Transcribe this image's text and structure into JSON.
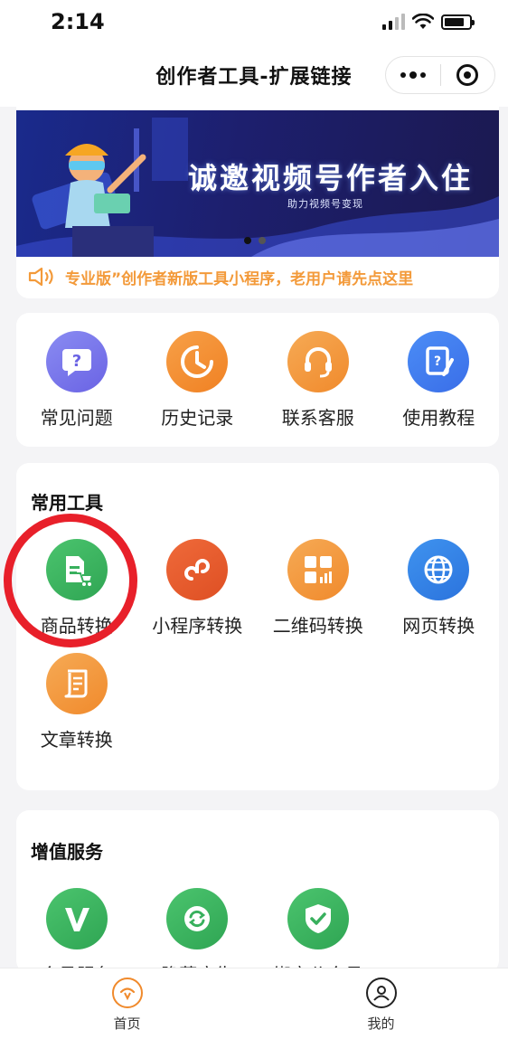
{
  "status": {
    "time": "2:14"
  },
  "nav": {
    "title": "创作者工具-扩展链接"
  },
  "banner": {
    "title": "诚邀视频号作者入住",
    "subtitle": "助力视频号变现",
    "notice": "专业版”创作者新版工具小程序，老用户请先点这里"
  },
  "quick": [
    {
      "label": "常见问题",
      "icon": "question-chat-icon",
      "color": "#7b78ec"
    },
    {
      "label": "历史记录",
      "icon": "clock-icon",
      "color": "#f08a2c"
    },
    {
      "label": "联系客服",
      "icon": "headset-icon",
      "color": "#f29340"
    },
    {
      "label": "使用教程",
      "icon": "tutorial-doc-icon",
      "color": "#3f7ff0"
    }
  ],
  "tools": {
    "title": "常用工具",
    "items": [
      {
        "label": "商品转换",
        "icon": "product-cart-icon",
        "color": "#38b05d"
      },
      {
        "label": "小程序转换",
        "icon": "miniprogram-icon",
        "color": "#e45a2c"
      },
      {
        "label": "二维码转换",
        "icon": "grid-chart-icon",
        "color": "#f29340"
      },
      {
        "label": "网页转换",
        "icon": "globe-icon",
        "color": "#3582e6"
      },
      {
        "label": "文章转换",
        "icon": "scroll-icon",
        "color": "#f29340"
      }
    ]
  },
  "vas": {
    "title": "增值服务",
    "items": [
      {
        "label": "会员服务",
        "icon": "vip-v-icon",
        "color": "#38b05d"
      },
      {
        "label": "隐藏广告",
        "icon": "refresh-icon",
        "color": "#38b05d"
      },
      {
        "label": "绑定公众号",
        "icon": "shield-check-icon",
        "color": "#38b05d"
      }
    ]
  },
  "tabbar": {
    "home": "首页",
    "mine": "我的"
  }
}
